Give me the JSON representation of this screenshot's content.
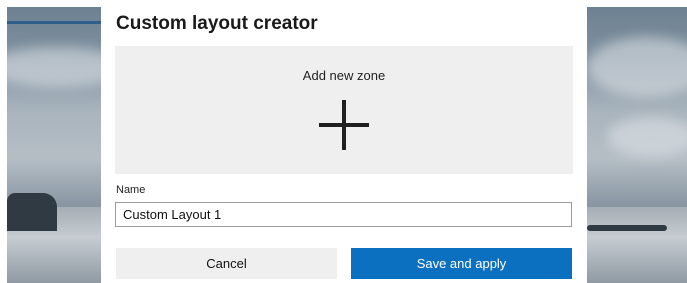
{
  "dialog": {
    "title": "Custom layout creator",
    "zone_area": {
      "label": "Add new zone",
      "icon": "plus-icon"
    },
    "name_field": {
      "label": "Name",
      "value": "Custom Layout 1"
    },
    "buttons": {
      "cancel_label": "Cancel",
      "save_label": "Save and apply"
    }
  },
  "colors": {
    "accent": "#0c70c0",
    "zone_background": "#efefef",
    "dialog_background": "#ffffff"
  }
}
